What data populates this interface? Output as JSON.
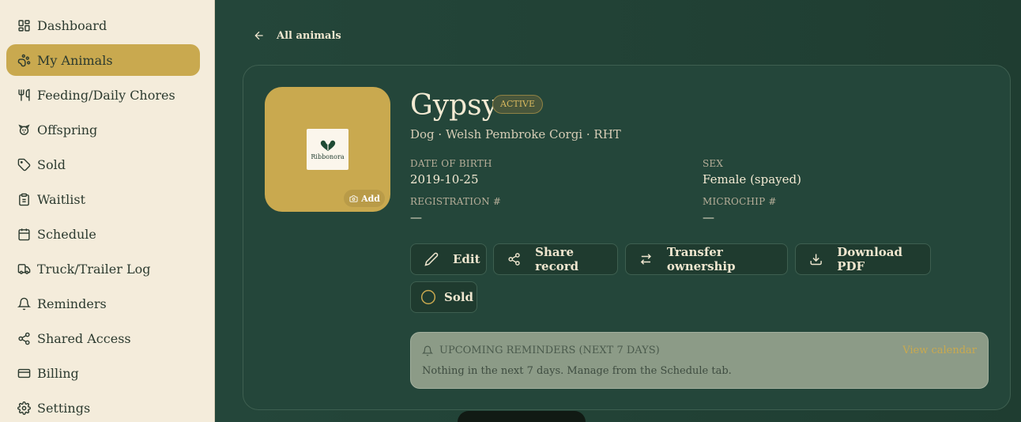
{
  "sidebar": {
    "items": [
      {
        "label": "Dashboard",
        "icon": "dashboard-icon"
      },
      {
        "label": "My Animals",
        "icon": "paw-icon",
        "active": true
      },
      {
        "label": "Feeding/Daily Chores",
        "icon": "utensils-icon"
      },
      {
        "label": "Offspring",
        "icon": "puppy-icon"
      },
      {
        "label": "Sold",
        "icon": "tag-icon"
      },
      {
        "label": "Waitlist",
        "icon": "clipboard-icon"
      },
      {
        "label": "Schedule",
        "icon": "calendar-icon"
      },
      {
        "label": "Truck/Trailer Log",
        "icon": "truck-icon"
      },
      {
        "label": "Reminders",
        "icon": "bell-icon"
      },
      {
        "label": "Shared Access",
        "icon": "share-icon"
      },
      {
        "label": "Billing",
        "icon": "credit-card-icon"
      },
      {
        "label": "Settings",
        "icon": "gear-icon"
      }
    ]
  },
  "back": {
    "label": "All animals"
  },
  "animal": {
    "name": "Gypsy",
    "status": "ACTIVE",
    "subtitle": "Dog · Welsh Pembroke Corgi · RHT",
    "photo": {
      "logo_text": "Ribbonora",
      "add_label": "Add"
    },
    "fields": {
      "dob_label": "DATE OF BIRTH",
      "dob_value": "2019-10-25",
      "sex_label": "SEX",
      "sex_value": "Female (spayed)",
      "reg_label": "REGISTRATION #",
      "reg_value": "—",
      "chip_label": "MICROCHIP #",
      "chip_value": "—"
    }
  },
  "actions": {
    "edit": "Edit",
    "share": "Share record",
    "transfer": "Transfer ownership",
    "download": "Download PDF",
    "sold": "Sold"
  },
  "reminders": {
    "title": "UPCOMING REMINDERS (NEXT 7 DAYS)",
    "link": "View calendar",
    "empty_text": "Nothing in the next 7 days. Manage from the Schedule tab."
  },
  "colors": {
    "accent": "#c9a94f",
    "sidebar_bg": "#f4ecdb",
    "main_bg": "#24463a"
  }
}
